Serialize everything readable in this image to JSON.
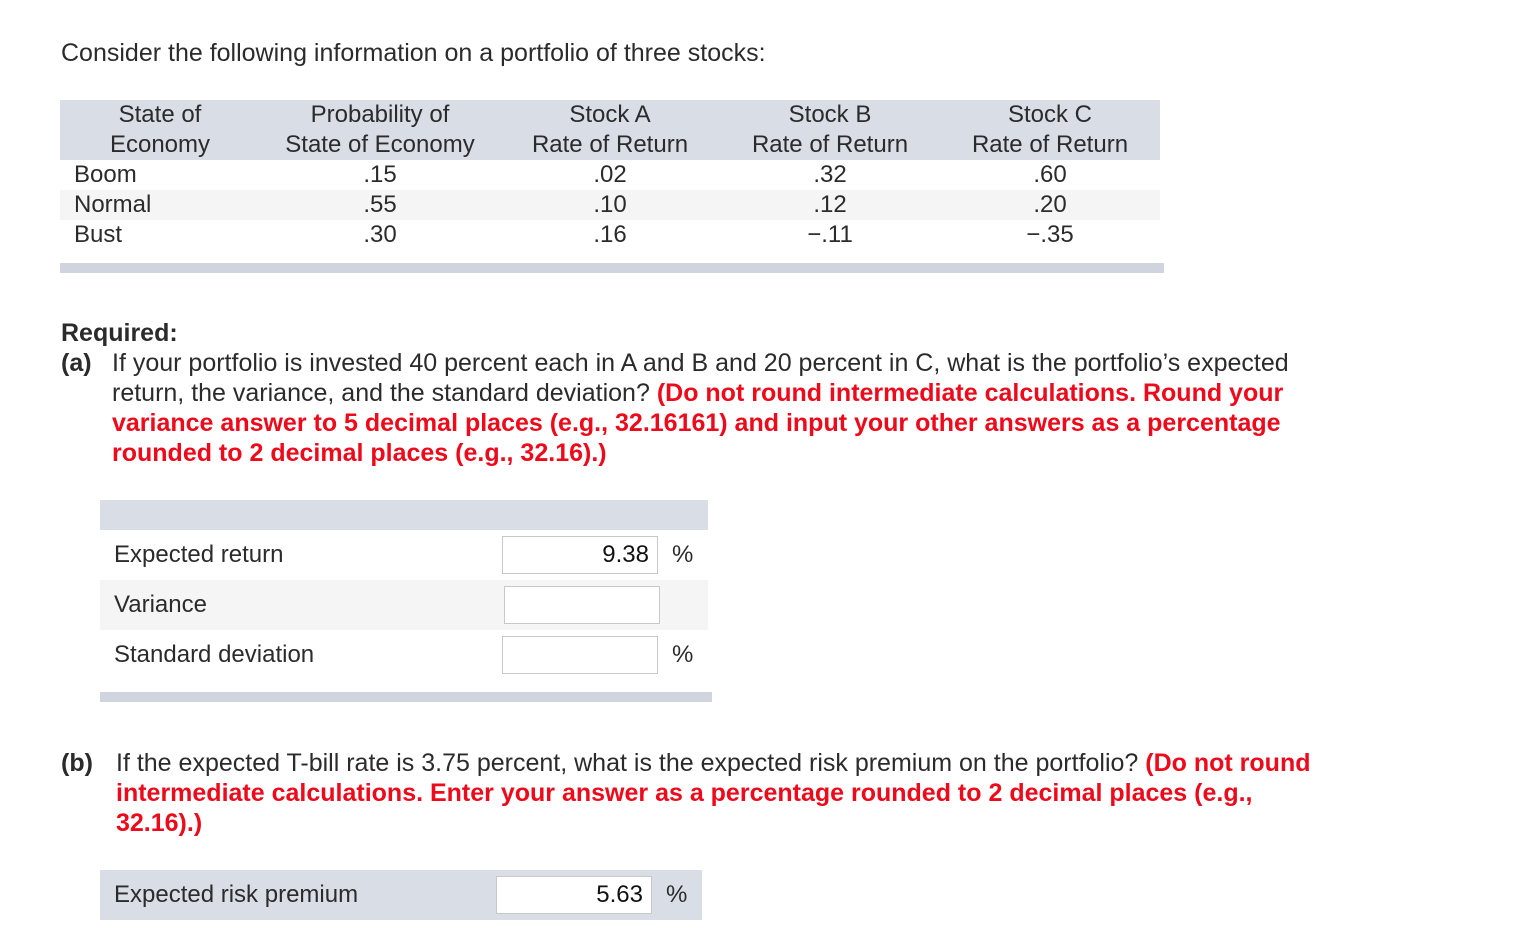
{
  "intro": "Consider the following information on a portfolio of three stocks:",
  "table": {
    "headers": [
      [
        "State of",
        "Economy"
      ],
      [
        "Probability of",
        "State of Economy"
      ],
      [
        "Stock A",
        "Rate of Return"
      ],
      [
        "Stock B",
        "Rate of Return"
      ],
      [
        "Stock C",
        "Rate of Return"
      ]
    ],
    "rows": [
      [
        "Boom",
        ".15",
        ".02",
        ".32",
        ".60"
      ],
      [
        "Normal",
        ".55",
        ".10",
        ".12",
        ".20"
      ],
      [
        "Bust",
        ".30",
        ".16",
        "−.11",
        "−.35"
      ]
    ]
  },
  "required_label": "Required:",
  "part_a": {
    "label": "(a)",
    "text": "If your portfolio is invested 40 percent each in A and B and 20 percent in C, what is the portfolio’s expected return, the variance, and the standard deviation?",
    "instruction": "(Do not round intermediate calculations. Round your variance answer to 5 decimal places (e.g., 32.16161) and input your other answers as a percentage rounded to 2 decimal places (e.g., 32.16).)",
    "fields": [
      {
        "label": "Expected return",
        "value": "9.38",
        "unit": "%"
      },
      {
        "label": "Variance",
        "value": "",
        "unit": ""
      },
      {
        "label": "Standard deviation",
        "value": "",
        "unit": "%"
      }
    ]
  },
  "part_b": {
    "label": "(b)",
    "text": "If the expected T-bill rate is 3.75 percent, what is the expected risk premium on the portfolio?",
    "instruction": "(Do not round intermediate calculations. Enter your answer as a percentage rounded to 2 decimal places (e.g., 32.16).)",
    "field": {
      "label": "Expected risk premium",
      "value": "5.63",
      "unit": "%"
    }
  },
  "colors": {
    "header_bg": "#d9dde6",
    "alt_row_bg": "#f5f5f5",
    "instruction_red": "#ec0a1b"
  }
}
